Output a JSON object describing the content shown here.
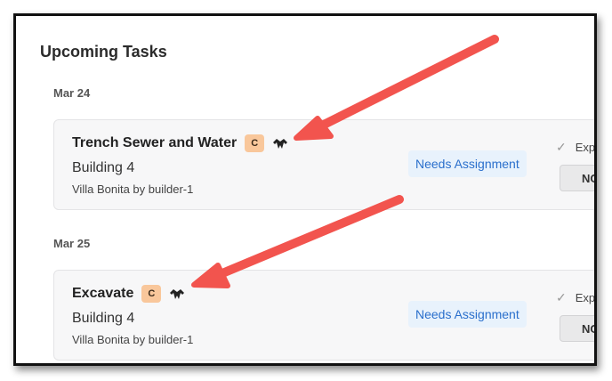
{
  "page": {
    "section_title": "Upcoming Tasks"
  },
  "groups": [
    {
      "date": "Mar 24",
      "task": {
        "title": "Trench Sewer and Water",
        "badge": "C",
        "building": "Building 4",
        "project": "Villa Bonita by builder-1",
        "assignment": "Needs Assignment",
        "expand_label": "Exp",
        "button_label": "NO"
      }
    },
    {
      "date": "Mar 25",
      "task": {
        "title": "Excavate",
        "badge": "C",
        "building": "Building 4",
        "project": "Villa Bonita by builder-1",
        "assignment": "Needs Assignment",
        "expand_label": "Exp",
        "button_label": "NO"
      }
    }
  ],
  "icons": {
    "crew": "crew-icon",
    "check": "check-icon"
  },
  "colors": {
    "annotation_arrow": "#f2544e",
    "badge_bg": "#f9c79b",
    "assignment_text": "#2a6fcc",
    "assignment_bg": "#e8f2fc"
  }
}
